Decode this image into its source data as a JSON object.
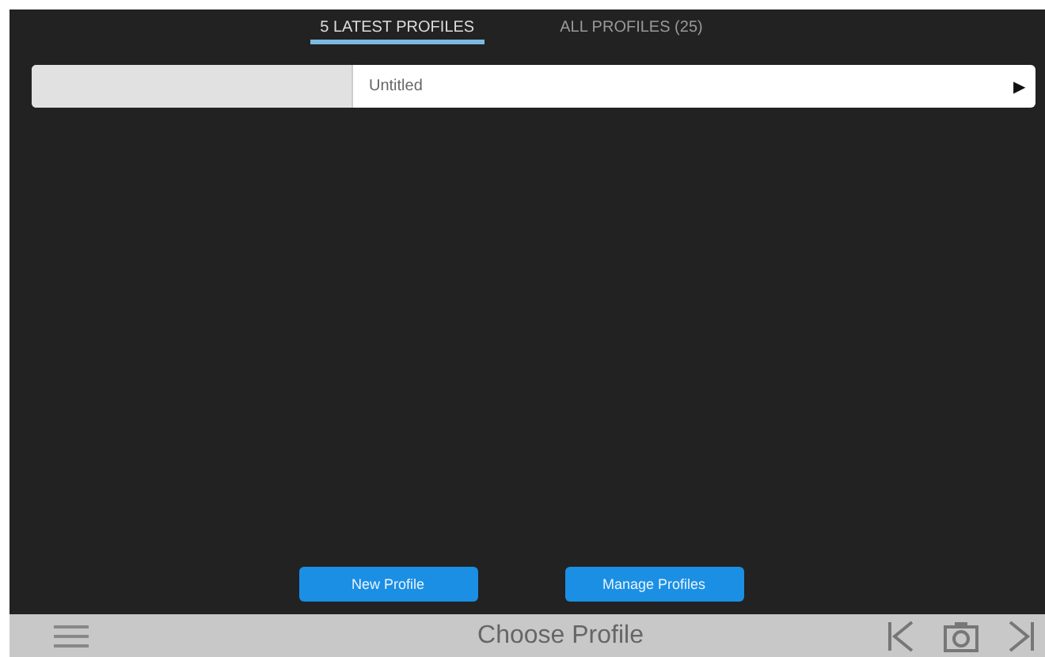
{
  "tabs": [
    {
      "label": "5 LATEST PROFILES",
      "selected": true
    },
    {
      "label": "ALL PROFILES (25)",
      "selected": false
    }
  ],
  "profiles": [
    {
      "name": "Untitled",
      "arrow": "▶"
    }
  ],
  "buttons": [
    "New Profile",
    "Manage Profiles"
  ],
  "bottom_bar": {
    "title": "Choose Profile"
  }
}
